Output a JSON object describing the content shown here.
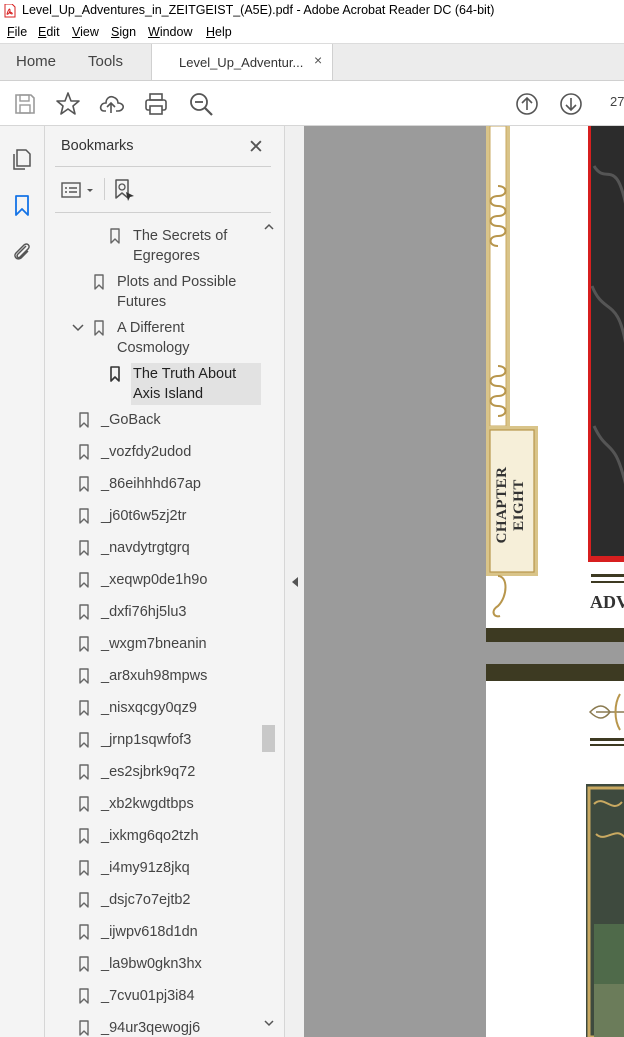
{
  "window": {
    "title": "Level_Up_Adventures_in_ZEITGEIST_(A5E).pdf - Adobe Acrobat Reader DC (64-bit)"
  },
  "menu": [
    "File",
    "Edit",
    "View",
    "Sign",
    "Window",
    "Help"
  ],
  "tabs": {
    "home": "Home",
    "tools": "Tools",
    "document": "Level_Up_Adventur...",
    "close_glyph": "×"
  },
  "toolbar": {
    "page_number": "27"
  },
  "bookmarks": {
    "title": "Bookmarks",
    "close_glyph": "✕",
    "items": [
      {
        "label": "The Secrets of Egregores",
        "lines": [
          "The Secrets of",
          "Egregores"
        ]
      },
      {
        "label": "Plots and Possible Futures",
        "lines": [
          "Plots and Possible",
          "Futures"
        ]
      },
      {
        "label": "A Different Cosmology",
        "lines": [
          "A Different",
          "Cosmology"
        ],
        "expanded": true
      },
      {
        "label": "The Truth About Axis Island",
        "lines": [
          "The Truth About",
          "Axis Island"
        ],
        "selected": true
      },
      {
        "label": "_GoBack"
      },
      {
        "label": "_vozfdy2udod"
      },
      {
        "label": "_86eihhhd67ap"
      },
      {
        "label": "_j60t6w5zj2tr"
      },
      {
        "label": "_navdytrgtgrq"
      },
      {
        "label": "_xeqwp0de1h9o"
      },
      {
        "label": "_dxfi76hj5lu3"
      },
      {
        "label": "_wxgm7bneanin"
      },
      {
        "label": "_ar8xuh98mpws"
      },
      {
        "label": "_nisxqcgy0qz9"
      },
      {
        "label": "_jrnp1sqwfof3"
      },
      {
        "label": "_es2sjbrk9q72"
      },
      {
        "label": "_xb2kwgdtbps"
      },
      {
        "label": "_ixkmg6qo2tzh"
      },
      {
        "label": "_i4my91z8jkq"
      },
      {
        "label": "_dsjc7o7ejtb2"
      },
      {
        "label": "_ijwpv618d1dn"
      },
      {
        "label": "_la9bw0gkn3hx"
      },
      {
        "label": "_7cvu01pj3i84"
      },
      {
        "label": "_94ur3qewogj6"
      }
    ]
  },
  "document": {
    "chapter_label": "CHAPTER EIGHT",
    "heading_fragment": "ADV"
  },
  "colors": {
    "accent_blue": "#1473e6",
    "pdf_red": "#d71f1f",
    "gold": "#c9a961",
    "dark_bar": "#3d3a22"
  }
}
